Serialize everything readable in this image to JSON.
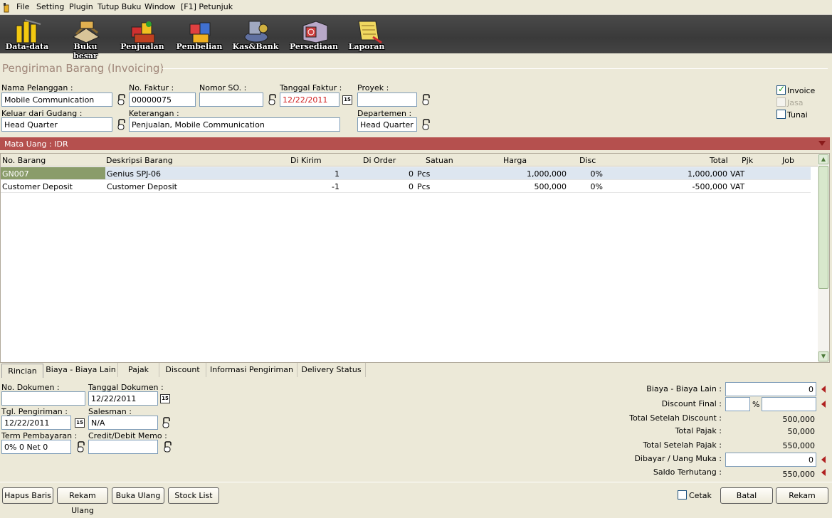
{
  "menu": {
    "items": [
      "File",
      "Setting",
      "Plugin",
      "Tutup Buku",
      "Window",
      "[F1] Petunjuk"
    ]
  },
  "toolbar": {
    "items": [
      {
        "label": "Data-data",
        "icon": "data-icon"
      },
      {
        "label": "Buku besar",
        "icon": "ledger-icon"
      },
      {
        "label": "Penjualan",
        "icon": "sales-icon"
      },
      {
        "label": "Pembelian",
        "icon": "purchase-icon"
      },
      {
        "label": "Kas&Bank",
        "icon": "cash-bank-icon"
      },
      {
        "label": "Persediaan",
        "icon": "inventory-icon"
      },
      {
        "label": "Laporan",
        "icon": "report-icon"
      }
    ]
  },
  "page": {
    "title": "Pengiriman Barang (Invoicing)"
  },
  "form": {
    "customer_label": "Nama Pelanggan :",
    "customer": "Mobile Communication",
    "invoice_no_label": "No. Faktur :",
    "invoice_no": "00000075",
    "so_label": "Nomor SO. :",
    "so": "",
    "invoice_date_label": "Tanggal Faktur :",
    "invoice_date": "12/22/2011",
    "project_label": "Proyek :",
    "project": "",
    "warehouse_label": "Keluar dari Gudang :",
    "warehouse": "Head Quarter",
    "notes_label": "Keterangan :",
    "notes": "Penjualan, Mobile Communication",
    "department_label": "Departemen :",
    "department": "Head Quarter",
    "calendar_glyph": "15"
  },
  "options": {
    "invoice": "Invoice",
    "jasa": "Jasa",
    "tunai": "Tunai"
  },
  "currency": {
    "label": "Mata Uang : IDR"
  },
  "grid": {
    "columns": [
      "No. Barang",
      "Deskripsi Barang",
      "Di Kirim",
      "Di Order",
      "Satuan",
      "Harga",
      "Disc",
      "Total",
      "Pjk",
      "Job"
    ],
    "rows": [
      {
        "no": "GN007",
        "desc": "Genius SPJ-06",
        "kirim": "1",
        "order": "0",
        "satuan": "Pcs",
        "harga": "1,000,000",
        "disc": "0%",
        "total": "1,000,000",
        "pjk": "VAT",
        "job": ""
      },
      {
        "no": "Customer Deposit",
        "desc": "Customer Deposit",
        "kirim": "-1",
        "order": "0",
        "satuan": "Pcs",
        "harga": "500,000",
        "disc": "0%",
        "total": "-500,000",
        "pjk": "VAT",
        "job": ""
      }
    ]
  },
  "tabs": [
    "Rincian",
    "Biaya - Biaya Lain",
    "Pajak",
    "Discount",
    "Informasi Pengiriman",
    "Delivery Status"
  ],
  "detail": {
    "doc_no_label": "No. Dokumen :",
    "doc_no": "",
    "doc_date_label": "Tanggal Dokumen :",
    "doc_date": "12/22/2011",
    "ship_date_label": "Tgl. Pengiriman :",
    "ship_date": "12/22/2011",
    "salesman_label": "Salesman :",
    "salesman": "N/A",
    "term_label": "Term Pembayaran :",
    "term": "0% 0 Net 0",
    "memo_label": "Credit/Debit Memo :",
    "memo": ""
  },
  "totals": {
    "other_costs_label": "Biaya - Biaya Lain :",
    "other_costs": "0",
    "discount_label": "Discount Final :",
    "discount_pct": "",
    "percent_sign": "%",
    "discount_amount": "",
    "after_discount_label": "Total Setelah Discount :",
    "after_discount": "500,000",
    "tax_label": "Total Pajak :",
    "tax": "50,000",
    "after_tax_label": "Total Setelah Pajak :",
    "after_tax": "550,000",
    "paid_label": "Dibayar / Uang Muka :",
    "paid": "0",
    "balance_label": "Saldo Terhutang :",
    "balance": "550,000"
  },
  "buttons": {
    "delete_row": "Hapus Baris",
    "rekam_ulang": "Rekam Ulang",
    "buka_ulang": "Buka Ulang",
    "stock_list": "Stock List",
    "cetak": "Cetak",
    "batal": "Batal",
    "rekam": "Rekam"
  },
  "colors": {
    "currency_bar": "#b5504e",
    "toolbar": "#3e3e3e",
    "title": "#a0877a",
    "date_red": "#d02020"
  }
}
